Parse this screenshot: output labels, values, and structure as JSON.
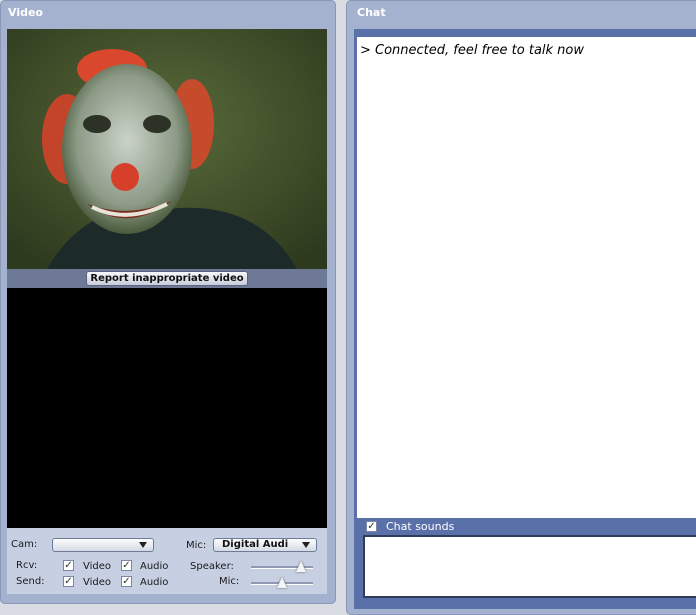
{
  "video_panel": {
    "title": "Video",
    "report_button": "Report inappropriate video",
    "controls": {
      "cam_label": "Cam:",
      "cam_value": "",
      "mic_label": "Mic:",
      "mic_value": "Digital Audi",
      "rcv_label": "Rcv:",
      "send_label": "Send:",
      "video_label": "Video",
      "audio_label": "Audio",
      "speaker_label": "Speaker:",
      "mic_volume_label": "Mic:",
      "speaker_level": 0.8,
      "mic_level": 0.5,
      "rcv_video_checked": true,
      "rcv_audio_checked": true,
      "send_video_checked": true,
      "send_audio_checked": true
    }
  },
  "chat_panel": {
    "title": "Chat",
    "messages": [
      "> Connected, feel free to talk now"
    ],
    "sounds_label": "Chat sounds",
    "sounds_checked": true,
    "input_value": ""
  },
  "colors": {
    "panel": "#a5b2cf",
    "chat_frame": "#5a70a8",
    "controls_bg": "#c7d0e3"
  }
}
